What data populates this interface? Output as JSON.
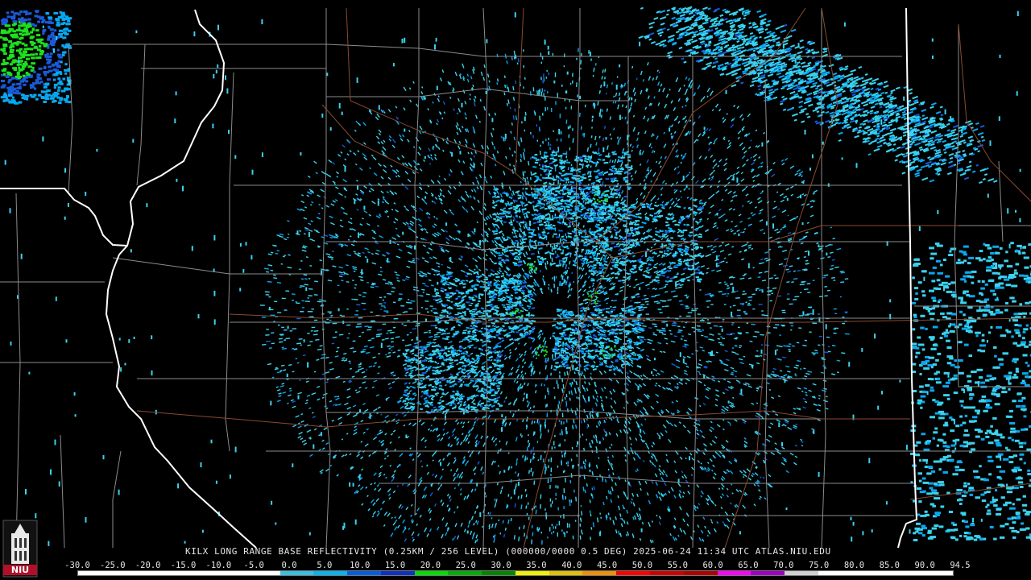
{
  "caption": "KILX LONG RANGE BASE REFLECTIVITY (0.25KM / 256 LEVEL) (000000/0000 0.5 DEG) 2025-06-24 11:34 UTC  ATLAS.NIU.EDU",
  "scale": {
    "labels": [
      "-30.0",
      "-25.0",
      "-20.0",
      "-15.0",
      "-10.0",
      "-5.0",
      "0.0",
      "5.0",
      "10.0",
      "15.0",
      "20.0",
      "25.0",
      "30.0",
      "35.0",
      "40.0",
      "45.0",
      "50.0",
      "55.0",
      "60.0",
      "65.0",
      "70.0",
      "75.0",
      "80.0",
      "85.0",
      "90.0",
      "94.5"
    ],
    "colors": [
      "#ffffff",
      "#ffffff",
      "#ffffff",
      "#ffffff",
      "#ffffff",
      "#ffffff",
      "#39c0e0",
      "#08b4f0",
      "#0060e0",
      "#1030c0",
      "#00e000",
      "#00b000",
      "#008800",
      "#f0f000",
      "#e0c000",
      "#f09000",
      "#ff0000",
      "#d00000",
      "#b00000",
      "#ff00ff",
      "#a000c0",
      "#d0d0d0",
      "#ffffff",
      "#ffffff",
      "#ffffff",
      "#ffffff"
    ]
  },
  "logo": {
    "text": "NIU"
  },
  "colors": {
    "county_line": "#8c8c8c",
    "state_line": "#ffffff",
    "road": "#8a4a30",
    "echo_light": "#3ad2ee",
    "echo_mid": "#08a8f0",
    "echo_blue": "#1a5ad8",
    "echo_green": "#1ee01e"
  }
}
